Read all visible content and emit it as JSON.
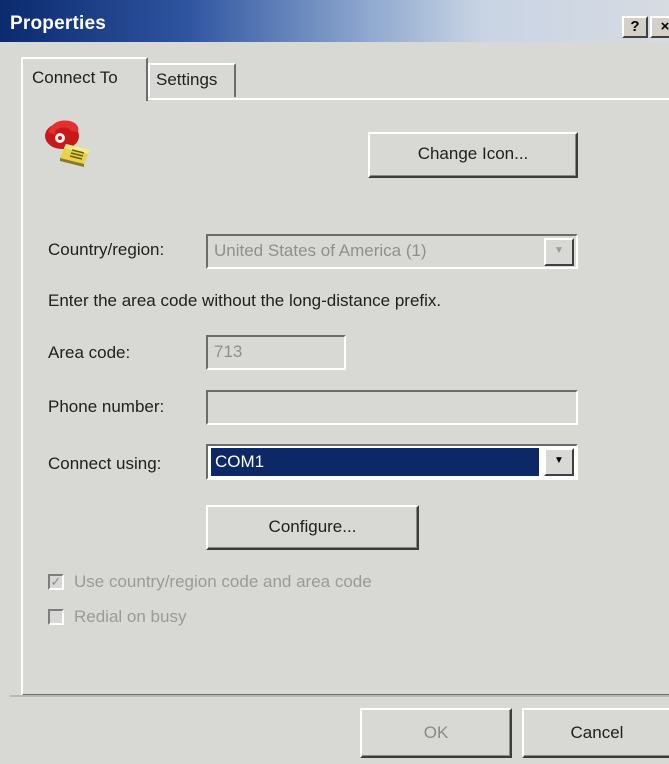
{
  "window": {
    "title": "Properties",
    "help_label": "?",
    "close_label": "×"
  },
  "tabs": [
    {
      "label": "Connect To",
      "selected": true
    },
    {
      "label": "Settings",
      "selected": false
    }
  ],
  "connect_to": {
    "icon": "red-telephone-icon",
    "change_icon_button": "Change Icon...",
    "country_label": "Country/region:",
    "country_value": "United States of America (1)",
    "hint_text": "Enter the area code without the long-distance prefix.",
    "area_code_label": "Area code:",
    "area_code_value": "713",
    "phone_label": "Phone number:",
    "phone_value": "",
    "connect_using_label": "Connect using:",
    "connect_using_value": "COM1",
    "configure_button": "Configure...",
    "use_country_code": {
      "label": "Use country/region code and area code",
      "checked": true,
      "enabled": false
    },
    "redial": {
      "label": "Redial on busy",
      "checked": false,
      "enabled": false
    }
  },
  "footer": {
    "ok_button": "OK",
    "cancel_button": "Cancel"
  },
  "colors": {
    "title_bar_start": "#0b2a6e",
    "selection": "#0c2866",
    "dialog_face": "#d8d8d4"
  }
}
